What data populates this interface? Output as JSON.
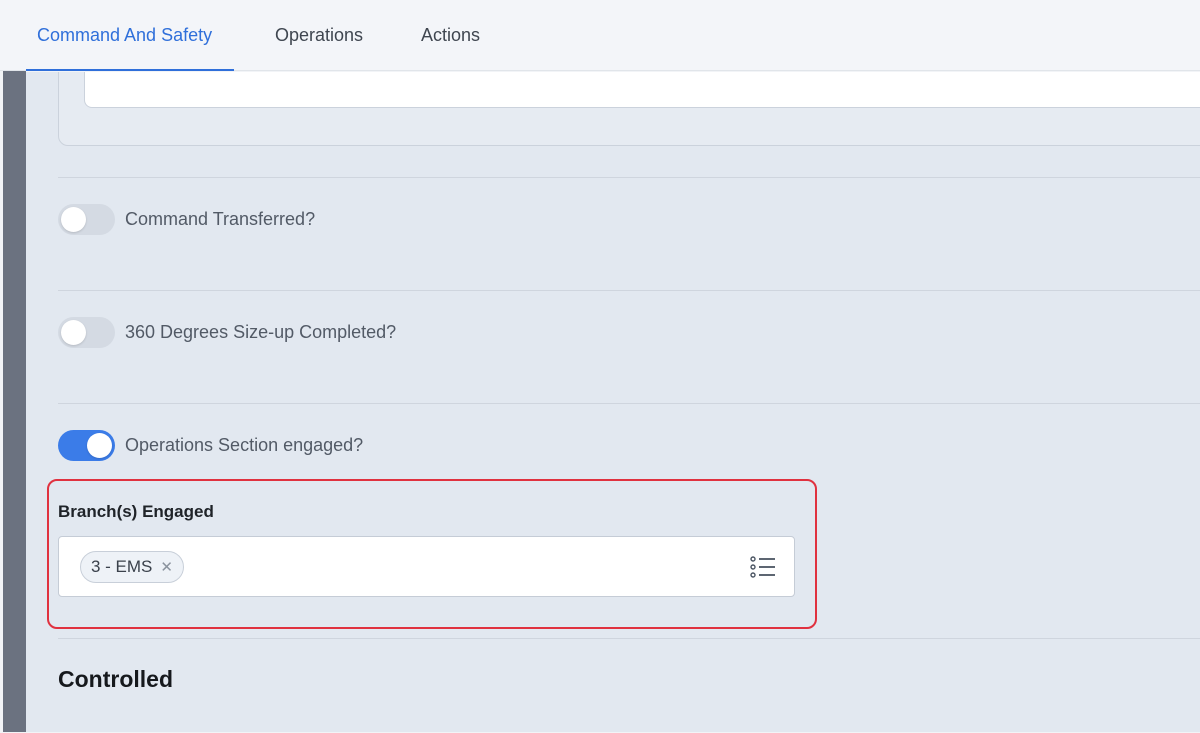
{
  "tabs": [
    {
      "label": "Command And Safety",
      "active": true
    },
    {
      "label": "Operations",
      "active": false
    },
    {
      "label": "Actions",
      "active": false
    }
  ],
  "toggles": [
    {
      "label": "Command Transferred?",
      "on": false
    },
    {
      "label": "360 Degrees Size-up Completed?",
      "on": false
    },
    {
      "label": "Operations Section engaged?",
      "on": true
    }
  ],
  "branches": {
    "label": "Branch(s) Engaged",
    "selected": [
      "3 - EMS"
    ],
    "list_icon": "list-icon"
  },
  "section": {
    "title": "Controlled"
  },
  "colors": {
    "accent": "#2f6fda",
    "toggle_on": "#3b7ce8",
    "highlight": "#e0313f"
  }
}
